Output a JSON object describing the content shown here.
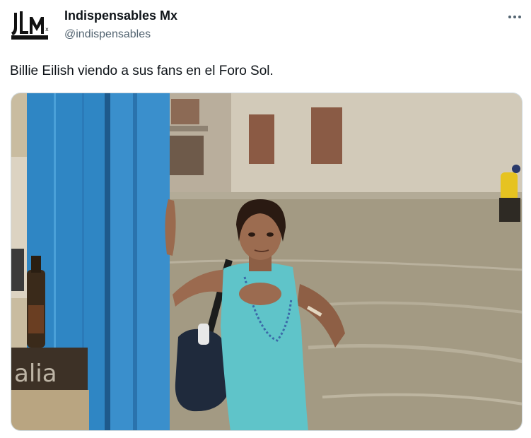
{
  "tweet": {
    "author": {
      "name": "Indispensables Mx",
      "handle": "@indispensables",
      "avatar_icon": "jlm-logo-icon",
      "avatar_text": "JLM"
    },
    "more_icon": "more-dots-icon",
    "text": "Billie Eilish viendo a sus fans en el Foro Sol.",
    "media": {
      "type": "photo",
      "watermark": "alia"
    }
  },
  "colors": {
    "text_primary": "#0f1419",
    "text_secondary": "#536471",
    "door_blue": "#2f86c4",
    "flood_water": "#a39a83",
    "building_wall": "#cdc5b4",
    "tank_top": "#5fc4c9"
  }
}
